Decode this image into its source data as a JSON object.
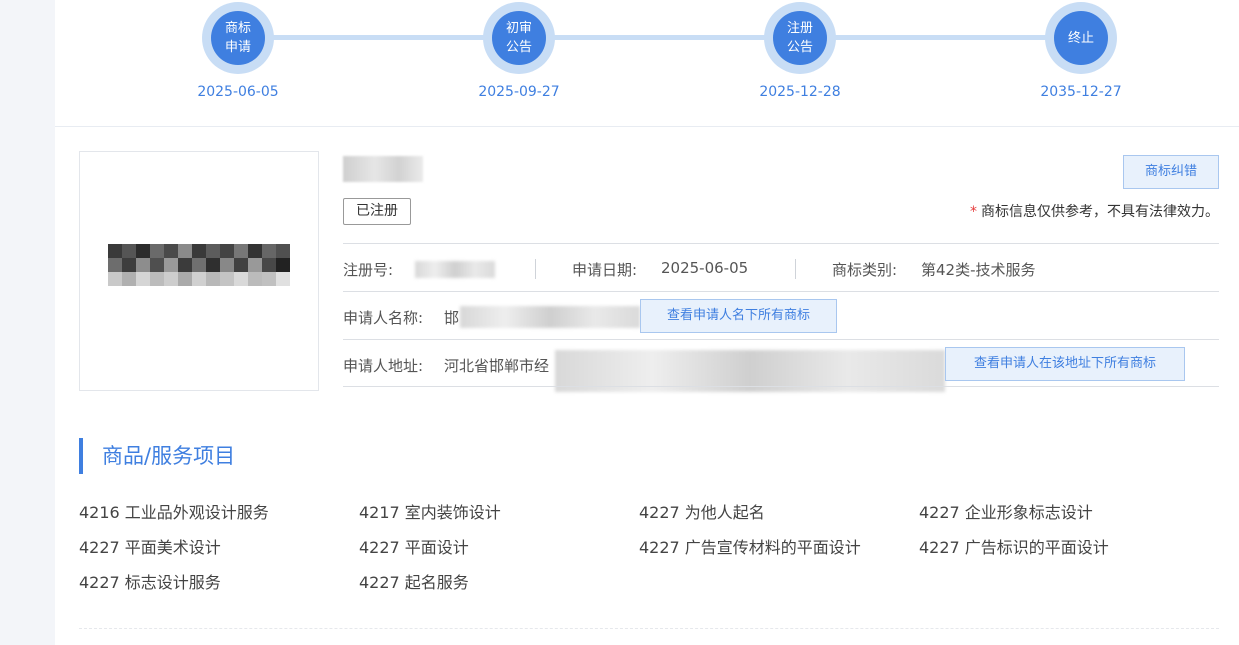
{
  "timeline": {
    "steps": [
      {
        "label": "商标\n申请",
        "date": "2025-06-05"
      },
      {
        "label": "初审\n公告",
        "date": "2025-09-27"
      },
      {
        "label": "注册\n公告",
        "date": "2025-12-28"
      },
      {
        "label": "终止",
        "date": "2035-12-27"
      }
    ]
  },
  "trademark": {
    "status": "已注册",
    "correct_button": "商标纠错",
    "notice_star": "*",
    "notice": "商标信息仅供参考，不具有法律效力。",
    "reg_no_label": "注册号:",
    "apply_date_label": "申请日期:",
    "apply_date": "2025-06-05",
    "class_label": "商标类别:",
    "class_value": "第42类-技术服务",
    "applicant_label": "申请人名称:",
    "applicant_prefix": "邯",
    "applicant_button": "查看申请人名下所有商标",
    "address_label": "申请人地址:",
    "address_prefix": "河北省邯郸市经",
    "address_button": "查看申请人在该地址下所有商标"
  },
  "goods": {
    "title": "商品/服务项目",
    "items": [
      "4216 工业品外观设计服务",
      "4217 室内装饰设计",
      "4227 为他人起名",
      "4227 企业形象标志设计",
      "4227 平面美术设计",
      "4227 平面设计",
      "4227 广告宣传材料的平面设计",
      "4227 广告标识的平面设计",
      "4227 标志设计服务",
      "4227 起名服务"
    ]
  },
  "colors": {
    "accent": "#3f7fe0",
    "ring": "#c8ddf5",
    "warning": "#e53b3b"
  }
}
